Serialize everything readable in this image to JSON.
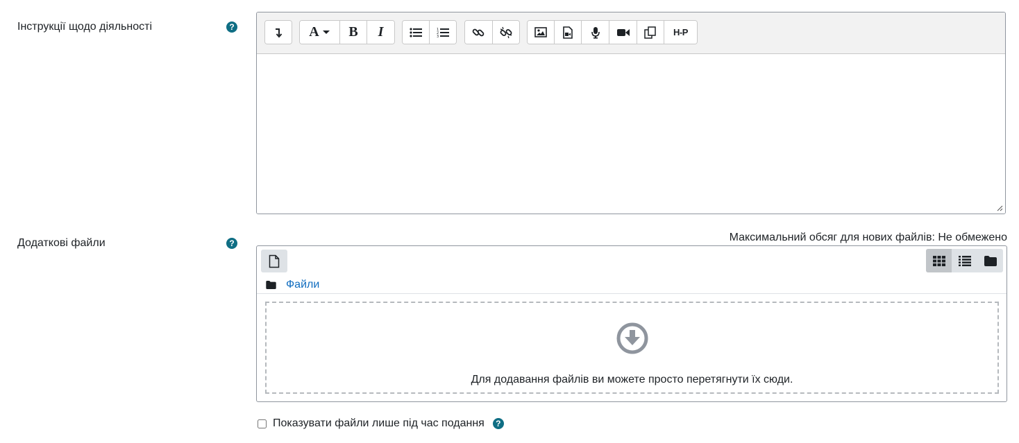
{
  "instructions": {
    "label": "Інструкції щодо діяльності",
    "help_icon": "question-circle-icon"
  },
  "toolbar": {
    "buttons": [
      {
        "icon": "collapse-toggle-icon"
      },
      {
        "icon": "font-style-icon",
        "text": "A"
      },
      {
        "icon": "bold-icon",
        "text": "B"
      },
      {
        "icon": "italic-icon",
        "text": "I"
      },
      {
        "icon": "bullet-list-icon"
      },
      {
        "icon": "numbered-list-icon"
      },
      {
        "icon": "link-icon"
      },
      {
        "icon": "unlink-icon"
      },
      {
        "icon": "image-icon"
      },
      {
        "icon": "media-icon"
      },
      {
        "icon": "record-audio-icon"
      },
      {
        "icon": "record-video-icon"
      },
      {
        "icon": "manage-files-icon"
      },
      {
        "icon": "h5p-icon",
        "text": "H-P"
      }
    ]
  },
  "extra_files": {
    "label": "Додаткові файли",
    "max_size": "Максимальний обсяг для нових файлів: Не обмежено",
    "path_link": "Файли",
    "drop_message": "Для додавання файлів ви можете просто перетягнути їх сюди."
  },
  "checkbox": {
    "label": "Показувати файли лише під час подання",
    "checked": false
  },
  "colors": {
    "help": "#0f6e84",
    "link": "#0f6cbf",
    "icon": "#1d2125"
  }
}
